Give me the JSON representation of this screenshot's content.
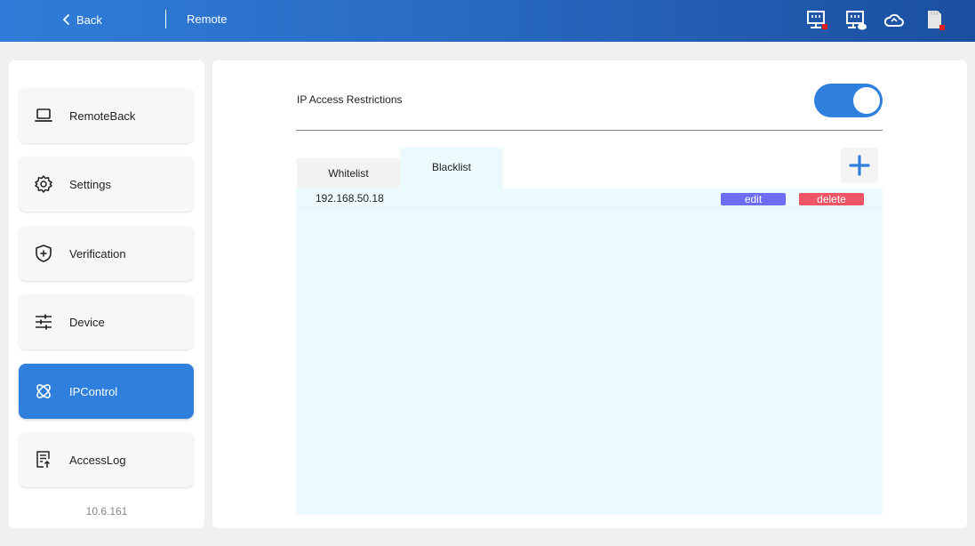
{
  "header": {
    "back_label": "Back",
    "title": "Remote",
    "status_icons": [
      "network-offline-icon",
      "network-cloud-icon",
      "cloud-icon",
      "sd-card-error-icon"
    ],
    "error_color": "#e02020"
  },
  "sidebar": {
    "items": [
      {
        "label": "RemoteBack",
        "icon": "laptop-icon",
        "active": false
      },
      {
        "label": "Settings",
        "icon": "gear-icon",
        "active": false
      },
      {
        "label": "Verification",
        "icon": "shield-plus-icon",
        "active": false
      },
      {
        "label": "Device",
        "icon": "sliders-icon",
        "active": false
      },
      {
        "label": "IPControl",
        "icon": "atom-icon",
        "active": true
      },
      {
        "label": "AccessLog",
        "icon": "log-upload-icon",
        "active": false
      }
    ],
    "version": "10.6.161"
  },
  "main": {
    "restriction_label": "IP Access Restrictions",
    "restriction_enabled": true,
    "tabs": [
      {
        "label": "Whitelist",
        "active": false
      },
      {
        "label": "Blacklist",
        "active": true
      }
    ],
    "add_icon": "plus-icon",
    "list": [
      {
        "ip": "192.168.50.18",
        "edit_label": "edit",
        "delete_label": "delete"
      }
    ]
  },
  "colors": {
    "accent": "#2f80de",
    "edit": "#6c6cf5",
    "delete": "#f05565",
    "list_bg": "#edfafd"
  }
}
